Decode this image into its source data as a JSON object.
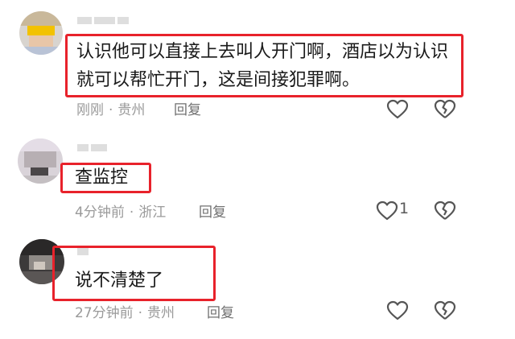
{
  "comments": [
    {
      "username": "",
      "text_line1": "认识他可以直接上去叫人开门啊，酒店以为认识",
      "text_line2": "就可以帮忙开门，这是间接犯罪啊。",
      "time": "刚刚",
      "location": "贵州",
      "reply_label": "回复",
      "like_count": ""
    },
    {
      "username": "",
      "text_line1": "查监控",
      "time": "4分钟前",
      "location": "浙江",
      "reply_label": "回复",
      "like_count": "1"
    },
    {
      "username": "",
      "text_line1": "说不清楚了",
      "time": "27分钟前",
      "location": "贵州",
      "reply_label": "回复",
      "like_count": ""
    }
  ],
  "separator": "·",
  "colors": {
    "highlight_border": "#e8222b",
    "text": "#1a1a1a",
    "meta": "#9a9a9a",
    "icon": "#555555"
  },
  "icons": {
    "like": "heart-outline-icon",
    "dislike": "broken-heart-icon"
  }
}
